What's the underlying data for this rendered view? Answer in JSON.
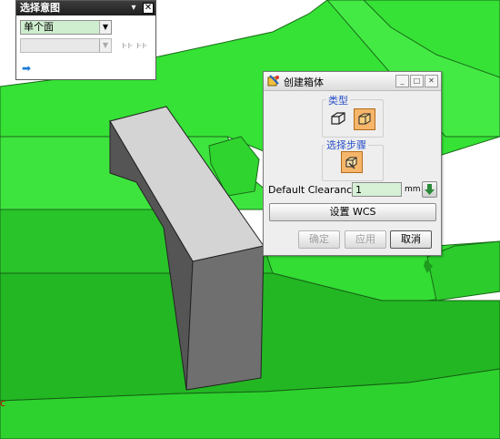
{
  "selection_intent": {
    "title": "选择意图",
    "filter_value": "单个面",
    "secondary_value": "",
    "pin_glyph": "▾",
    "close_glyph": "✕",
    "arrow_glyph": "▼",
    "tangent_icons": "ⱶⱶ ⱶⱶ",
    "next_arrow": "➡"
  },
  "create_box_dialog": {
    "title": "创建箱体",
    "window_buttons": [
      "_",
      "□",
      "✕"
    ],
    "type_label": "类型",
    "select_step_label": "选择步骤",
    "clearance_label": "Default Clearance",
    "clearance_value": "1",
    "clearance_unit": "mm",
    "wcs_button": "设置 WCS",
    "ok_button": "确定",
    "apply_button": "应用",
    "cancel_button": "取消"
  },
  "corner_mark": "c",
  "colors": {
    "green_face": "#33e033",
    "green_dark": "#23b023",
    "gray_block": "#d6d6d6",
    "dialog_accent": "#2950c8",
    "toggle_orange": "#f5b56a"
  },
  "icons": [
    "dialog-app-icon",
    "box-type-icon",
    "box-mold-icon",
    "select-face-icon",
    "next-arrow-icon",
    "reverse-direction-icon",
    "tangent-icon"
  ]
}
